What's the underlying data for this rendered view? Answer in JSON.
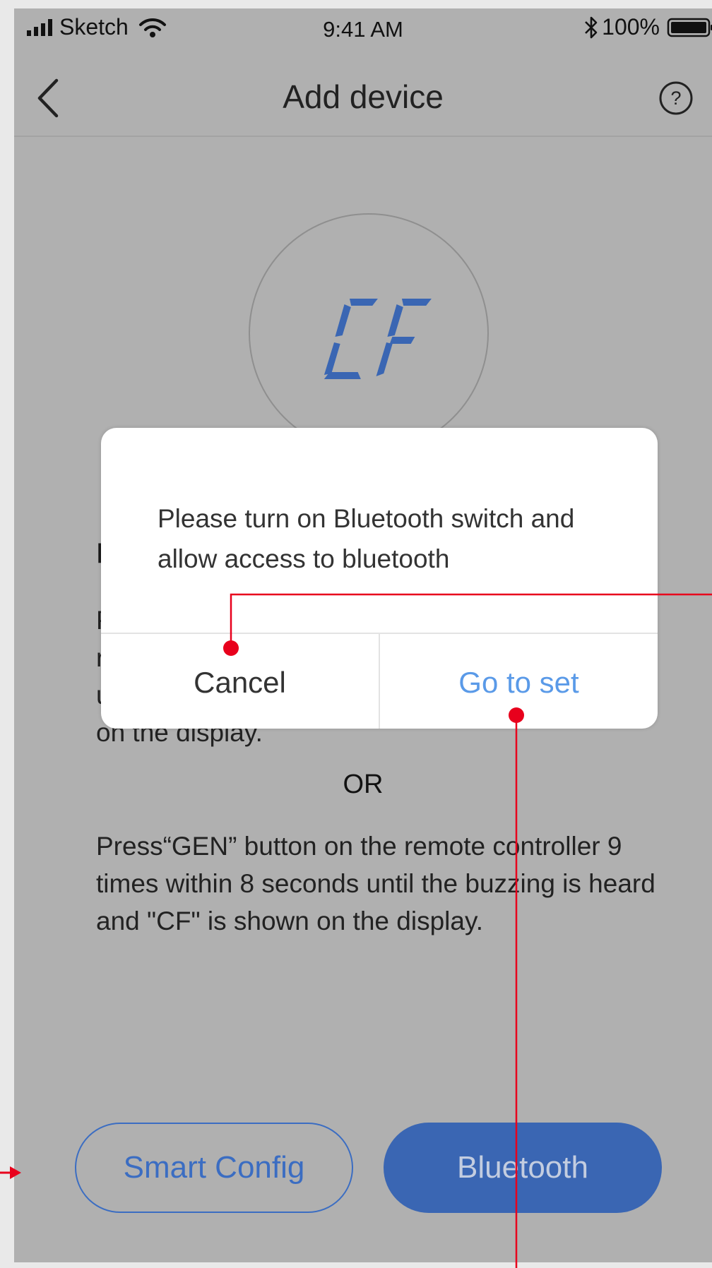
{
  "status_bar": {
    "carrier": "Sketch",
    "time": "9:41 AM",
    "battery": "100%"
  },
  "nav": {
    "title": "Add device",
    "back_icon": "chevron-left-icon",
    "help_icon": "question-circle-icon"
  },
  "illustration": {
    "display_text": "CF"
  },
  "instructions": {
    "heading": "P",
    "step1_lines": [
      "P",
      "r",
      "u",
      "on the display."
    ],
    "or_label": "OR",
    "step2": "Press“GEN” button on the remote controller 9 times within 8 seconds until the buzzing is heard and \"CF\" is shown on the display."
  },
  "buttons": {
    "smart_config": "Smart Config",
    "bluetooth": "Bluetooth"
  },
  "dialog": {
    "message": "Please turn on Bluetooth switch and allow access to bluetooth",
    "cancel": "Cancel",
    "go_to_set": "Go to set"
  },
  "colors": {
    "accent": "#3b6dc2",
    "dialog_link": "#5a9ae8",
    "annotation": "#e8001c",
    "overlay": "#b0b0b0"
  }
}
